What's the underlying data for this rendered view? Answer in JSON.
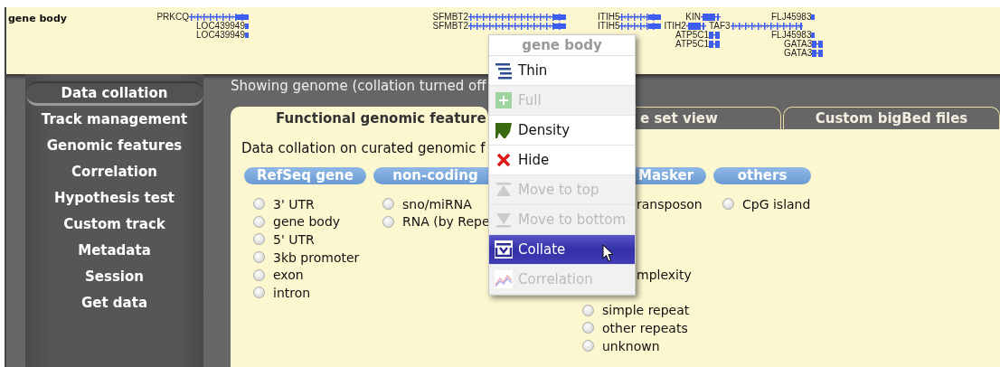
{
  "track": {
    "label": "gene body",
    "clusters": [
      {
        "lines": [
          {
            "genes": [
              {
                "name": "PRKCQ",
                "kind": "reverse"
              }
            ]
          },
          {
            "genes": [
              {
                "name": "LOC439949",
                "kind": "tick"
              }
            ]
          },
          {
            "genes": [
              {
                "name": "LOC439949",
                "kind": "tick"
              }
            ]
          }
        ]
      },
      {
        "lines": [
          {
            "genes": [
              {
                "name": "SFMBT2",
                "kind": "reverse"
              }
            ]
          },
          {
            "genes": [
              {
                "name": "SFMBT2",
                "kind": "reverse"
              }
            ]
          }
        ]
      },
      {
        "lines": [
          {
            "genes": [
              {
                "name": "ITIH5",
                "kind": "reverse"
              },
              {
                "name": "KIN",
                "kind": "block"
              }
            ]
          },
          {
            "genes": [
              {
                "name": "ITIH5",
                "kind": "reverse"
              },
              {
                "name": "ITIH2",
                "kind": "block"
              },
              {
                "name": "TAF3",
                "kind": "forward"
              }
            ]
          },
          {
            "genes": [
              {
                "name": "ATP5C1",
                "kind": "small"
              }
            ]
          },
          {
            "genes": [
              {
                "name": "ATP5C1",
                "kind": "small"
              }
            ]
          }
        ]
      },
      {
        "lines": [
          {
            "genes": [
              {
                "name": "FLJ45983",
                "kind": "tick"
              }
            ]
          },
          {
            "genes": [
              {
                "name": "FLJ45983",
                "kind": "tick"
              }
            ]
          },
          {
            "genes": [
              {
                "name": "GATA3",
                "kind": "small"
              }
            ]
          },
          {
            "genes": [
              {
                "name": "GATA3",
                "kind": "small"
              }
            ]
          }
        ]
      }
    ]
  },
  "sidebar": {
    "items": [
      {
        "label": "Data collation",
        "selected": true
      },
      {
        "label": "Track management",
        "selected": false
      },
      {
        "label": "Genomic features",
        "selected": false
      },
      {
        "label": "Correlation",
        "selected": false
      },
      {
        "label": "Hypothesis test",
        "selected": false
      },
      {
        "label": "Custom track",
        "selected": false
      },
      {
        "label": "Metadata",
        "selected": false
      },
      {
        "label": "Session",
        "selected": false
      },
      {
        "label": "Get data",
        "selected": false
      }
    ]
  },
  "status": "Showing genome (collation turned off",
  "tabs": [
    {
      "label": "Functional genomic feature",
      "selected": true
    },
    {
      "label": "e set view",
      "selected": false
    },
    {
      "label": "Custom bigBed files",
      "selected": false
    }
  ],
  "description": "Data collation on curated genomic f",
  "categories": [
    {
      "title": "RefSeq gene",
      "items": [
        {
          "label": "3' UTR",
          "kind": "radio",
          "selected": false
        },
        {
          "label": "gene body",
          "kind": "radio",
          "selected": false
        },
        {
          "label": "5' UTR",
          "kind": "radio",
          "selected": false
        },
        {
          "label": "3kb promoter",
          "kind": "radio",
          "selected": false
        },
        {
          "label": "exon",
          "kind": "radio",
          "selected": false
        },
        {
          "label": "intron",
          "kind": "radio",
          "selected": false
        }
      ]
    },
    {
      "title": "non-coding",
      "items": [
        {
          "label": "sno/miRNA",
          "kind": "radio",
          "selected": false
        },
        {
          "label": "RNA (by Repe",
          "kind": "radio",
          "selected": false
        }
      ]
    },
    {
      "title": "Masker",
      "items": [
        {
          "label": "ransposon",
          "kind": "clipped"
        },
        {
          "label": "mplexity",
          "kind": "clipped"
        },
        {
          "label": "simple repeat",
          "kind": "radio",
          "selected": false
        },
        {
          "label": "other repeats",
          "kind": "radio",
          "selected": false
        },
        {
          "label": "unknown",
          "kind": "radio",
          "selected": false
        }
      ]
    },
    {
      "title": "others",
      "items": [
        {
          "label": "CpG island",
          "kind": "radio",
          "selected": false
        }
      ]
    }
  ],
  "menu": {
    "title": "gene body",
    "items": [
      {
        "label": "Thin",
        "kind": "thin",
        "disabled": false,
        "selected": false
      },
      {
        "label": "Full",
        "kind": "full",
        "disabled": true,
        "selected": false
      },
      {
        "label": "Density",
        "kind": "density",
        "disabled": false,
        "selected": false
      },
      {
        "label": "Hide",
        "kind": "hide",
        "disabled": false,
        "selected": false
      },
      {
        "label": "Move to top",
        "kind": "top",
        "disabled": true,
        "selected": false
      },
      {
        "label": "Move to bottom",
        "kind": "bottom",
        "disabled": true,
        "selected": false
      },
      {
        "label": "Collate",
        "kind": "collate",
        "disabled": false,
        "selected": true
      },
      {
        "label": "Correlation",
        "kind": "correlation",
        "disabled": true,
        "selected": false
      }
    ]
  }
}
